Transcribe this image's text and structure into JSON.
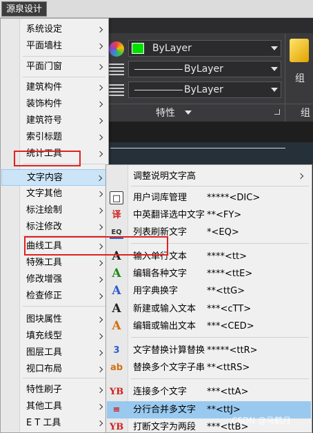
{
  "app_menu": {
    "label": "源泉设计"
  },
  "ribbon": {
    "color_combo": "ByLayer",
    "linetype_combo": "ByLayer",
    "lineweight_combo": "ByLayer",
    "properties_label": "特性",
    "group_label": "组",
    "group_label_bottom": "组",
    "colors": {
      "swatch": "#00e000",
      "ribbon_bg": "#3a3a3d"
    }
  },
  "main_menu": {
    "items": [
      {
        "label": "系统设定"
      },
      {
        "label": "平面墙柱"
      },
      {
        "label": "平面门窗"
      },
      {
        "label": "建筑构件"
      },
      {
        "label": "装饰构件"
      },
      {
        "label": "建筑符号"
      },
      {
        "label": "索引标题"
      },
      {
        "label": "统计工具"
      },
      {
        "label": "文字内容"
      },
      {
        "label": "文字其他"
      },
      {
        "label": "标注绘制"
      },
      {
        "label": "标注修改"
      },
      {
        "label": "曲线工具"
      },
      {
        "label": "特殊工具"
      },
      {
        "label": "修改增强"
      },
      {
        "label": "检查修正"
      },
      {
        "label": "图块属性"
      },
      {
        "label": "填充线型"
      },
      {
        "label": "图层工具"
      },
      {
        "label": "视口布局"
      },
      {
        "label": "特性刷子"
      },
      {
        "label": "其他工具"
      },
      {
        "label": "E T 工具"
      }
    ],
    "active_index": 8
  },
  "sub_menu": {
    "items": [
      {
        "label": "调整说明文字高",
        "cmd": "",
        "icon": ""
      },
      {
        "label": "用户词库管理",
        "cmd": "*****<DIC>",
        "icon": "book-icon"
      },
      {
        "label": "中英翻译选中文字",
        "cmd": "**<FY>",
        "icon": "translate-icon"
      },
      {
        "label": "列表刷新文字",
        "cmd": "*<EQ>",
        "icon": "eq-icon"
      },
      {
        "label": "输入单行文本",
        "cmd": "****<tt>",
        "icon": "text-a-icon"
      },
      {
        "label": "编辑各种文字",
        "cmd": "****<ttE>",
        "icon": "edit-text-icon"
      },
      {
        "label": "用字典换字",
        "cmd": "**<ttG>",
        "icon": "dictionary-icon"
      },
      {
        "label": "新建或输入文本",
        "cmd": "***<cTT>",
        "icon": "new-text-icon"
      },
      {
        "label": "编辑或输出文本",
        "cmd": "***<CED>",
        "icon": "export-text-icon"
      },
      {
        "label": "文字替换计算替换",
        "cmd": "*****<ttR>",
        "icon": "calc-replace-icon"
      },
      {
        "label": "替换多个文字子串",
        "cmd": "**<ttRS>",
        "icon": "replace-multi-icon"
      },
      {
        "label": "连接多个文字",
        "cmd": "***<ttA>",
        "icon": "join-text-icon"
      },
      {
        "label": "分行合并多文字",
        "cmd": "**<ttJ>",
        "icon": "split-merge-icon"
      },
      {
        "label": "打断文字为两段",
        "cmd": "***<ttB>",
        "icon": "break-text-icon"
      }
    ],
    "active_index": 12,
    "glyphs": {
      "book-icon": "□",
      "translate-icon": "译",
      "eq-icon": "EQ",
      "text-a-icon": "A",
      "edit-text-icon": "A",
      "dictionary-icon": "A",
      "new-text-icon": "A",
      "export-text-icon": "A",
      "calc-replace-icon": "3",
      "replace-multi-icon": "ab",
      "join-text-icon": "YB",
      "split-merge-icon": "≡",
      "break-text-icon": "YB"
    }
  },
  "watermark": "CSDN @马鹤月"
}
